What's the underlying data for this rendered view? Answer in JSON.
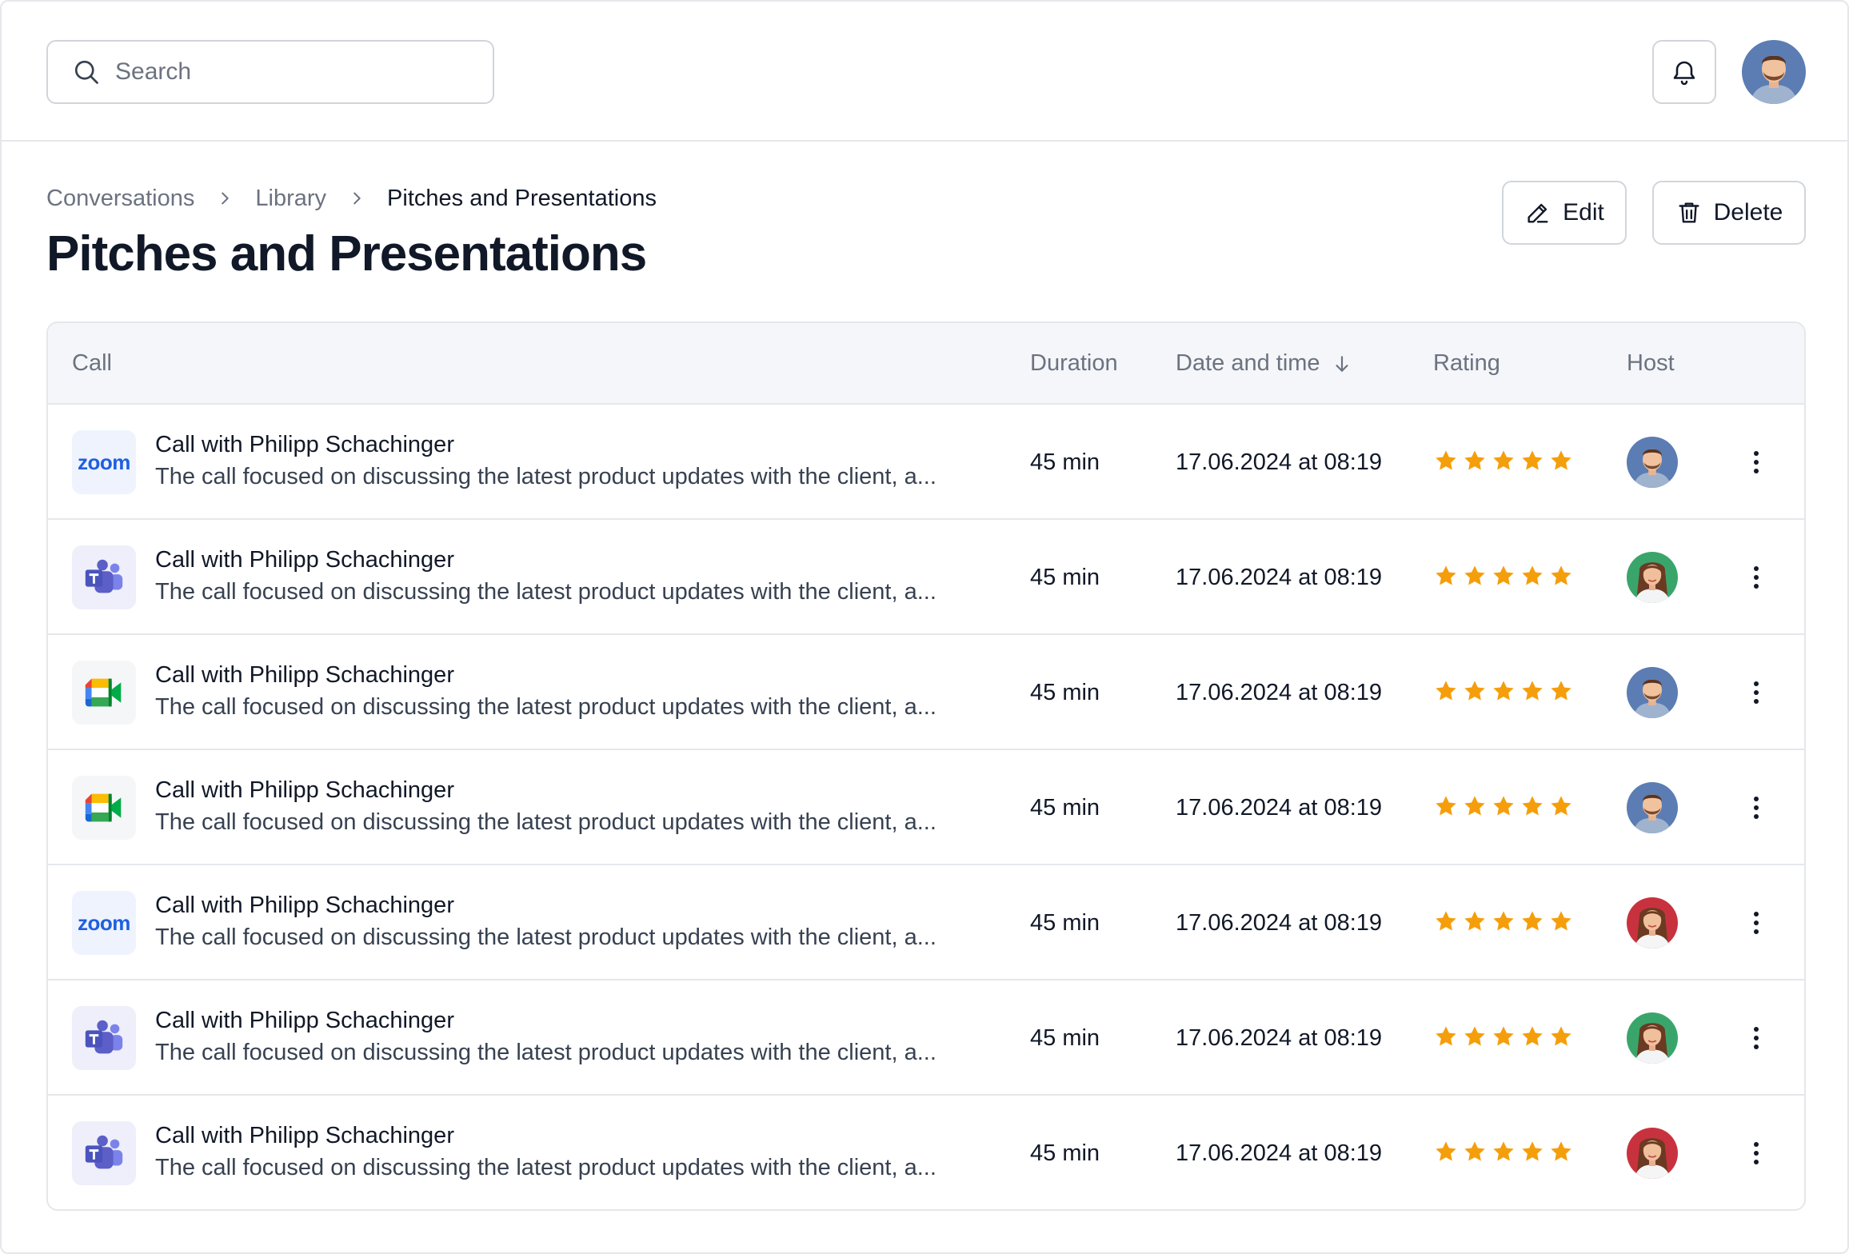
{
  "search": {
    "placeholder": "Search"
  },
  "header": {
    "breadcrumb": [
      "Conversations",
      "Library",
      "Pitches and Presentations"
    ],
    "title": "Pitches and Presentations",
    "edit_label": "Edit",
    "delete_label": "Delete"
  },
  "table": {
    "columns": {
      "call": "Call",
      "duration": "Duration",
      "date": "Date and time",
      "rating": "Rating",
      "host": "Host"
    },
    "rows": [
      {
        "app": "zoom",
        "app_label": "zoom",
        "title": "Call with Philipp Schachinger",
        "description": "The call focused on discussing the latest product updates with the client, a...",
        "duration": "45 min",
        "datetime": "17.06.2024 at 08:19",
        "rating": 5,
        "host": "male"
      },
      {
        "app": "teams",
        "app_label": "",
        "title": "Call with Philipp Schachinger",
        "description": "The call focused on discussing the latest product updates with the client, a...",
        "duration": "45 min",
        "datetime": "17.06.2024 at 08:19",
        "rating": 5,
        "host": "female-green"
      },
      {
        "app": "meet",
        "app_label": "",
        "title": "Call with Philipp Schachinger",
        "description": "The call focused on discussing the latest product updates with the client, a...",
        "duration": "45 min",
        "datetime": "17.06.2024 at 08:19",
        "rating": 5,
        "host": "male"
      },
      {
        "app": "meet",
        "app_label": "",
        "title": "Call with Philipp Schachinger",
        "description": "The call focused on discussing the latest product updates with the client, a...",
        "duration": "45 min",
        "datetime": "17.06.2024 at 08:19",
        "rating": 5,
        "host": "male"
      },
      {
        "app": "zoom",
        "app_label": "zoom",
        "title": "Call with Philipp Schachinger",
        "description": "The call focused on discussing the latest product updates with the client, a...",
        "duration": "45 min",
        "datetime": "17.06.2024 at 08:19",
        "rating": 5,
        "host": "female-red"
      },
      {
        "app": "teams",
        "app_label": "",
        "title": "Call with Philipp Schachinger",
        "description": "The call focused on discussing the latest product updates with the client, a...",
        "duration": "45 min",
        "datetime": "17.06.2024 at 08:19",
        "rating": 5,
        "host": "female-green"
      },
      {
        "app": "teams",
        "app_label": "",
        "title": "Call with Philipp Schachinger",
        "description": "The call focused on discussing the latest product updates with the client, a...",
        "duration": "45 min",
        "datetime": "17.06.2024 at 08:19",
        "rating": 5,
        "host": "female-red"
      }
    ]
  },
  "colors": {
    "star": "#f59e0b",
    "border": "#e5e7eb",
    "header_bg": "#f4f6f9",
    "zoom": "#1f5fe0",
    "teams": "#5b5fc7"
  },
  "icons": {
    "search": "search-icon",
    "bell": "bell-icon",
    "edit": "pencil-icon",
    "delete": "trash-icon",
    "sort": "arrow-down-icon",
    "more": "kebab-menu-icon"
  }
}
